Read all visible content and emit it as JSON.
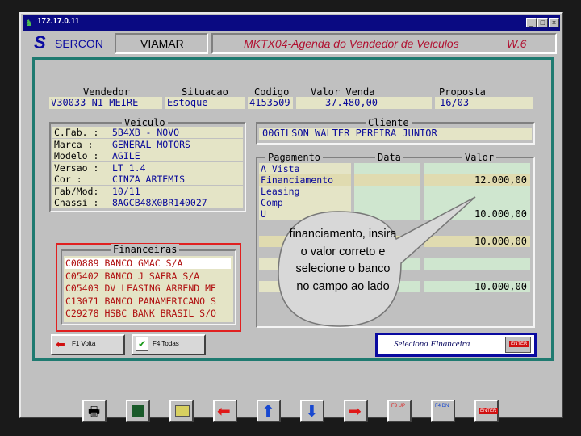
{
  "window": {
    "title": "172.17.0.11",
    "min": "_",
    "max": "□",
    "close": "×"
  },
  "header": {
    "brand": "SERCON",
    "company": "VIAMAR",
    "screen_title": "MKTX04-Agenda do Vendedor de Veiculos",
    "version": "W.6"
  },
  "top_table": {
    "headers": [
      "Vendedor",
      "Situacao",
      "Codigo",
      "Valor Venda",
      "Proposta"
    ],
    "values": [
      "V30033-N1-MEIRE",
      "Estoque",
      "4153509",
      "37.480,00",
      "16/03"
    ]
  },
  "veiculo": {
    "title": "Veiculo",
    "rows": [
      {
        "label": "C.Fab. :",
        "value": "5B4XB - NOVO"
      },
      {
        "label": "Marca  :",
        "value": "GENERAL MOTORS"
      },
      {
        "label": "Modelo :",
        "value": "AGILE"
      },
      {
        "label": "Versao :",
        "value": "LT 1.4"
      },
      {
        "label": "Cor    :",
        "value": "CINZA ARTEMIS"
      },
      {
        "label": "Fab/Mod:",
        "value": "10/11"
      },
      {
        "label": "Chassi :",
        "value": "8AGCB48X0BR140027"
      }
    ]
  },
  "cliente": {
    "title": "Cliente",
    "value": "00GILSON WALTER PEREIRA JUNIOR"
  },
  "pagamento": {
    "headers": [
      "Pagamento",
      "Data",
      "Valor"
    ],
    "rows": [
      {
        "label": "A Vista",
        "valor": ""
      },
      {
        "label": "Financiamento",
        "valor": "12.000,00"
      },
      {
        "label": "Leasing",
        "valor": ""
      },
      {
        "label": "Comp",
        "valor": ""
      },
      {
        "label": "U",
        "valor": "10.000,00"
      },
      {
        "label": "",
        "valor": "10.000,00"
      },
      {
        "label": "",
        "valor": ""
      },
      {
        "label": "",
        "valor": "10.000,00"
      }
    ]
  },
  "financeiras": {
    "title": "Financeiras",
    "items": [
      "C00889 BANCO GMAC S/A",
      "C05402 BANCO J SAFRA S/A",
      "C05403 DV LEASING ARREND ME",
      "C13071 BANCO PANAMERICANO S",
      "C29278 HSBC BANK BRASIL S/O"
    ]
  },
  "callout": {
    "text": "financiamento, insira o valor correto e selecione o banco  no campo ao lado"
  },
  "buttons": {
    "volta": "F1 Volta",
    "todas": "F4 Todas",
    "enter": "ENTER",
    "status": "Seleciona Financeira"
  },
  "toolbar": {
    "f3": "F3 UP",
    "f4": "F4 DN",
    "enter": "ENTER"
  },
  "colors": {
    "title_bar": "#0a0a82",
    "frame": "#1f7a70",
    "panel": "#e4e4c6",
    "highlight": "#e0dbb0",
    "text_blue": "#0a0a9a",
    "header_red": "#b01030"
  }
}
